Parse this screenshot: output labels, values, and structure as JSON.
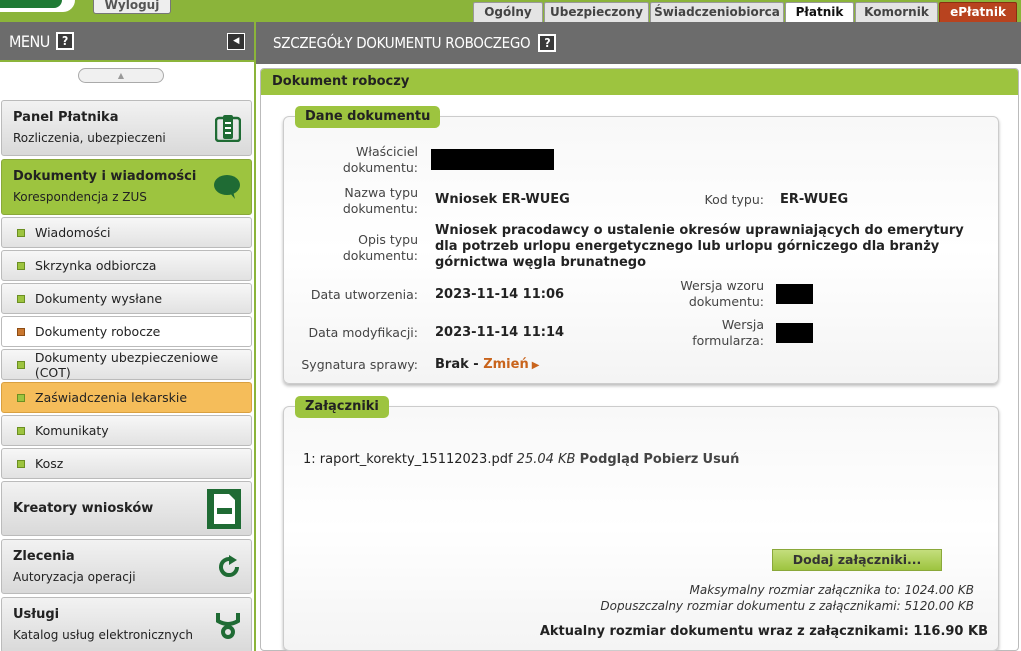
{
  "topbar": {
    "logout_label": "Wyloguj",
    "tabs": [
      {
        "label": "Ogólny",
        "width": 70
      },
      {
        "label": "Ubezpieczony",
        "width": 105
      },
      {
        "label": "Świadczeniobiorca",
        "width": 134
      },
      {
        "label": "Płatnik",
        "width": 69
      },
      {
        "label": "Komornik",
        "width": 83
      },
      {
        "label": "ePłatnik",
        "width": 78
      }
    ]
  },
  "sidebar": {
    "menu_label": "MENU",
    "help_label": "?",
    "panels": {
      "platnik": {
        "title": "Panel Płatnika",
        "subtitle": "Rozliczenia, ubezpieczeni"
      },
      "dokumenty": {
        "title": "Dokumenty i wiadomości",
        "subtitle": "Korespondencja z ZUS"
      },
      "kreatory": {
        "title": "Kreatory wniosków"
      },
      "zlecenia": {
        "title": "Zlecenia",
        "subtitle": "Autoryzacja operacji"
      },
      "uslugi": {
        "title": "Usługi",
        "subtitle": "Katalog usług elektronicznych"
      }
    },
    "items": [
      {
        "label": "Wiadomości"
      },
      {
        "label": "Skrzynka odbiorcza"
      },
      {
        "label": "Dokumenty wysłane"
      },
      {
        "label": "Dokumenty robocze"
      },
      {
        "label": "Dokumenty ubezpieczeniowe (COT)"
      },
      {
        "label": "Zaświadczenia lekarskie"
      },
      {
        "label": "Komunikaty"
      },
      {
        "label": "Kosz"
      }
    ]
  },
  "main": {
    "header_title": "SZCZEGÓŁY DOKUMENTU ROBOCZEGO",
    "help_label": "?",
    "card_title": "Dokument roboczy",
    "details": {
      "legend": "Dane dokumentu",
      "owner_label": "Właściciel dokumentu:",
      "type_name_label": "Nazwa typu dokumentu:",
      "type_name_value": "Wniosek ER-WUEG",
      "type_code_label": "Kod typu:",
      "type_code_value": "ER-WUEG",
      "type_desc_label": "Opis typu dokumentu:",
      "type_desc_value": "Wniosek pracodawcy o ustalenie okresów uprawniających do emerytury dla potrzeb urlopu energetycznego lub urlopu górniczego dla branży górnictwa węgla brunatnego",
      "created_label": "Data utworzenia:",
      "created_value": "2023-11-14 11:06",
      "template_version_label": "Wersja wzoru dokumentu:",
      "modified_label": "Data modyfikacji:",
      "modified_value": "2023-11-14 11:14",
      "form_version_label": "Wersja formularza:",
      "signature_label": "Sygnatura sprawy:",
      "signature_value": "Brak",
      "signature_sep": " - ",
      "change_link": "Zmień"
    },
    "attachments": {
      "legend": "Załączniki",
      "items": [
        {
          "index": "1:",
          "filename": "raport_korekty_15112023.pdf",
          "size": "25.04 KB",
          "preview": "Podgląd",
          "download": "Pobierz",
          "delete": "Usuń"
        }
      ],
      "add_button": "Dodaj załączniki...",
      "max_attachment": "Maksymalny rozmiar załącznika to: 1024.00 KB",
      "max_document": "Dopuszczalny rozmiar dokumentu z załącznikami: 5120.00 KB",
      "current_size": "Aktualny rozmiar dokumentu wraz z załącznikami: 116.90 KB"
    }
  }
}
